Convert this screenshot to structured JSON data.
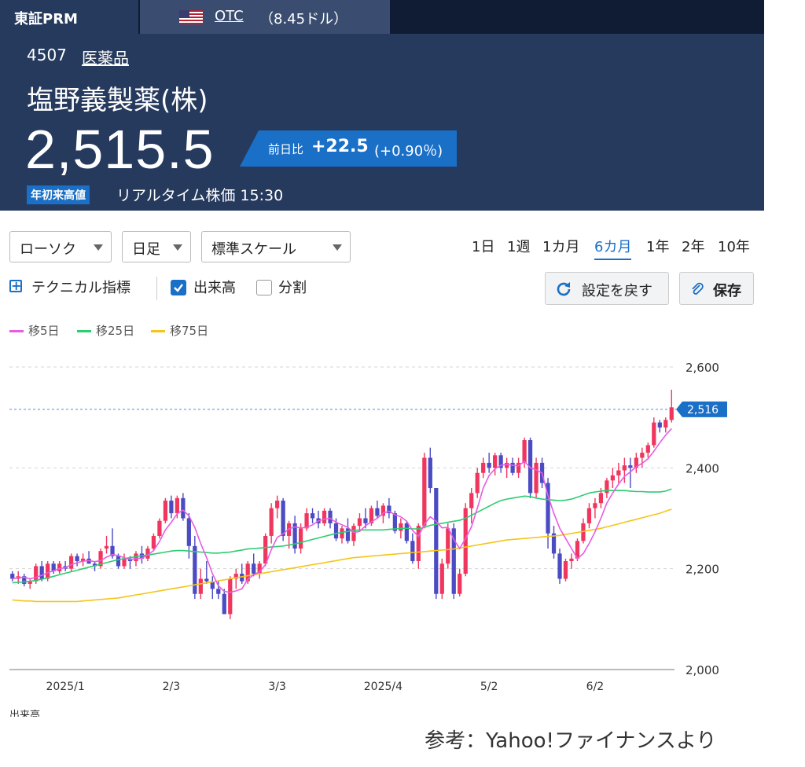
{
  "header": {
    "market_tab": "東証PRM",
    "otc_symbol": "OTC",
    "otc_price": "（8.45ドル）",
    "code": "4507",
    "sector": "医薬品",
    "company": "塩野義製薬(株)",
    "price": "2,515.5",
    "change_label": "前日比",
    "change_value": "+22.5",
    "change_pct": "(+0.90％)",
    "badge": "年初来高値",
    "realtime": "リアルタイム株価  15:30",
    "flag_icon": "us-flag-icon"
  },
  "controls": {
    "chart_type": "ローソク",
    "interval": "日足",
    "scale": "標準スケール",
    "periods": [
      {
        "label": "1日"
      },
      {
        "label": "1週"
      },
      {
        "label": "1カ月"
      },
      {
        "label": "6カ月",
        "active": true
      },
      {
        "label": "1年"
      },
      {
        "label": "2年"
      },
      {
        "label": "10年"
      }
    ],
    "technical": "テクニカル指標",
    "volume": "出来高",
    "volume_checked": true,
    "split": "分割",
    "split_checked": false,
    "reset": "設定を戻す",
    "save": "保存"
  },
  "legend": [
    {
      "label": "移5日",
      "color": "#e85ce0"
    },
    {
      "label": "移25日",
      "color": "#2ecc71"
    },
    {
      "label": "移75日",
      "color": "#f5c518"
    }
  ],
  "chart_data": {
    "type": "candlestick",
    "ylim": [
      2000,
      2600
    ],
    "yticks": [
      "2,600",
      "2,400",
      "2,200",
      "2,000"
    ],
    "current_label": "2,516",
    "current_value": 2516,
    "xticks": [
      {
        "label": "2025/1",
        "index": 9
      },
      {
        "label": "2/3",
        "index": 27
      },
      {
        "label": "3/3",
        "index": 45
      },
      {
        "label": "2025/4",
        "index": 63
      },
      {
        "label": "5/2",
        "index": 81
      },
      {
        "label": "6/2",
        "index": 99
      }
    ],
    "up_color": "#f0365e",
    "down_color": "#4b4bc4",
    "ohlc": [
      [
        2190,
        2195,
        2175,
        2180
      ],
      [
        2180,
        2195,
        2170,
        2185
      ],
      [
        2185,
        2190,
        2165,
        2170
      ],
      [
        2170,
        2180,
        2160,
        2175
      ],
      [
        2175,
        2210,
        2170,
        2205
      ],
      [
        2205,
        2215,
        2175,
        2180
      ],
      [
        2180,
        2215,
        2175,
        2210
      ],
      [
        2210,
        2215,
        2190,
        2195
      ],
      [
        2195,
        2215,
        2190,
        2210
      ],
      [
        2205,
        2215,
        2195,
        2200
      ],
      [
        2200,
        2230,
        2195,
        2225
      ],
      [
        2225,
        2230,
        2205,
        2215
      ],
      [
        2215,
        2230,
        2205,
        2220
      ],
      [
        2220,
        2235,
        2210,
        2210
      ],
      [
        2210,
        2215,
        2195,
        2205
      ],
      [
        2205,
        2240,
        2200,
        2235
      ],
      [
        2240,
        2265,
        2230,
        2245
      ],
      [
        2245,
        2280,
        2220,
        2225
      ],
      [
        2225,
        2230,
        2200,
        2205
      ],
      [
        2205,
        2230,
        2200,
        2220
      ],
      [
        2220,
        2225,
        2200,
        2215
      ],
      [
        2215,
        2235,
        2205,
        2230
      ],
      [
        2230,
        2245,
        2210,
        2220
      ],
      [
        2220,
        2245,
        2215,
        2240
      ],
      [
        2240,
        2270,
        2235,
        2265
      ],
      [
        2265,
        2300,
        2260,
        2295
      ],
      [
        2295,
        2340,
        2290,
        2335
      ],
      [
        2335,
        2345,
        2300,
        2310
      ],
      [
        2310,
        2345,
        2300,
        2340
      ],
      [
        2340,
        2350,
        2295,
        2300
      ],
      [
        2300,
        2310,
        2220,
        2245
      ],
      [
        2245,
        2265,
        2140,
        2150
      ],
      [
        2150,
        2200,
        2140,
        2180
      ],
      [
        2180,
        2215,
        2170,
        2175
      ],
      [
        2175,
        2185,
        2140,
        2160
      ],
      [
        2160,
        2175,
        2140,
        2150
      ],
      [
        2150,
        2160,
        2110,
        2110
      ],
      [
        2110,
        2185,
        2100,
        2180
      ],
      [
        2180,
        2200,
        2160,
        2190
      ],
      [
        2190,
        2210,
        2170,
        2175
      ],
      [
        2175,
        2215,
        2170,
        2210
      ],
      [
        2210,
        2230,
        2185,
        2190
      ],
      [
        2190,
        2215,
        2180,
        2210
      ],
      [
        2210,
        2270,
        2205,
        2265
      ],
      [
        2265,
        2330,
        2250,
        2320
      ],
      [
        2320,
        2345,
        2300,
        2335
      ],
      [
        2335,
        2340,
        2255,
        2265
      ],
      [
        2265,
        2295,
        2240,
        2290
      ],
      [
        2290,
        2305,
        2230,
        2240
      ],
      [
        2240,
        2290,
        2230,
        2280
      ],
      [
        2280,
        2320,
        2275,
        2310
      ],
      [
        2310,
        2320,
        2290,
        2300
      ],
      [
        2300,
        2315,
        2280,
        2290
      ],
      [
        2290,
        2320,
        2285,
        2315
      ],
      [
        2315,
        2320,
        2280,
        2290
      ],
      [
        2290,
        2300,
        2255,
        2260
      ],
      [
        2260,
        2285,
        2250,
        2280
      ],
      [
        2280,
        2300,
        2250,
        2255
      ],
      [
        2255,
        2290,
        2245,
        2285
      ],
      [
        2285,
        2310,
        2275,
        2300
      ],
      [
        2300,
        2320,
        2280,
        2290
      ],
      [
        2290,
        2325,
        2285,
        2320
      ],
      [
        2320,
        2335,
        2300,
        2305
      ],
      [
        2305,
        2330,
        2290,
        2325
      ],
      [
        2325,
        2340,
        2300,
        2310
      ],
      [
        2310,
        2315,
        2270,
        2275
      ],
      [
        2275,
        2300,
        2260,
        2290
      ],
      [
        2290,
        2295,
        2250,
        2255
      ],
      [
        2255,
        2270,
        2210,
        2215
      ],
      [
        2215,
        2290,
        2200,
        2285
      ],
      [
        2285,
        2430,
        2280,
        2420
      ],
      [
        2420,
        2440,
        2350,
        2360
      ],
      [
        2360,
        2290,
        2140,
        2150
      ],
      [
        2150,
        2220,
        2140,
        2210
      ],
      [
        2210,
        2290,
        2200,
        2280
      ],
      [
        2280,
        2290,
        2140,
        2150
      ],
      [
        2150,
        2200,
        2145,
        2190
      ],
      [
        2190,
        2330,
        2185,
        2320
      ],
      [
        2320,
        2360,
        2290,
        2350
      ],
      [
        2350,
        2400,
        2340,
        2390
      ],
      [
        2390,
        2420,
        2380,
        2410
      ],
      [
        2410,
        2430,
        2390,
        2400
      ],
      [
        2400,
        2430,
        2385,
        2425
      ],
      [
        2425,
        2430,
        2390,
        2400
      ],
      [
        2400,
        2420,
        2380,
        2410
      ],
      [
        2410,
        2420,
        2385,
        2390
      ],
      [
        2390,
        2420,
        2380,
        2410
      ],
      [
        2410,
        2460,
        2400,
        2455
      ],
      [
        2455,
        2460,
        2340,
        2350
      ],
      [
        2350,
        2420,
        2340,
        2410
      ],
      [
        2410,
        2420,
        2360,
        2370
      ],
      [
        2370,
        2380,
        2240,
        2270
      ],
      [
        2270,
        2285,
        2220,
        2230
      ],
      [
        2230,
        2240,
        2170,
        2180
      ],
      [
        2180,
        2220,
        2175,
        2215
      ],
      [
        2215,
        2230,
        2200,
        2220
      ],
      [
        2220,
        2260,
        2215,
        2255
      ],
      [
        2255,
        2300,
        2250,
        2290
      ],
      [
        2290,
        2330,
        2280,
        2320
      ],
      [
        2320,
        2340,
        2300,
        2330
      ],
      [
        2330,
        2360,
        2320,
        2350
      ],
      [
        2350,
        2380,
        2340,
        2375
      ],
      [
        2375,
        2400,
        2360,
        2385
      ],
      [
        2385,
        2410,
        2370,
        2395
      ],
      [
        2395,
        2420,
        2370,
        2405
      ],
      [
        2405,
        2420,
        2360,
        2400
      ],
      [
        2400,
        2430,
        2390,
        2420
      ],
      [
        2420,
        2440,
        2400,
        2430
      ],
      [
        2430,
        2450,
        2420,
        2445
      ],
      [
        2445,
        2500,
        2440,
        2490
      ],
      [
        2490,
        2495,
        2470,
        2480
      ],
      [
        2480,
        2500,
        2470,
        2495
      ],
      [
        2495,
        2555,
        2490,
        2520
      ]
    ],
    "ma5": [
      2180,
      2182,
      2183,
      2180,
      2183,
      2187,
      2192,
      2196,
      2200,
      2202,
      2208,
      2212,
      2215,
      2216,
      2214,
      2216,
      2223,
      2228,
      2226,
      2222,
      2218,
      2220,
      2221,
      2227,
      2236,
      2254,
      2277,
      2292,
      2309,
      2316,
      2305,
      2282,
      2250,
      2222,
      2190,
      2166,
      2155,
      2153,
      2156,
      2160,
      2179,
      2188,
      2194,
      2208,
      2238,
      2262,
      2269,
      2279,
      2283,
      2281,
      2282,
      2287,
      2295,
      2298,
      2300,
      2292,
      2287,
      2282,
      2272,
      2274,
      2285,
      2293,
      2300,
      2310,
      2314,
      2307,
      2303,
      2294,
      2276,
      2264,
      2288,
      2303,
      2294,
      2281,
      2282,
      2258,
      2240,
      2260,
      2283,
      2320,
      2360,
      2385,
      2398,
      2405,
      2407,
      2405,
      2404,
      2413,
      2400,
      2396,
      2390,
      2345,
      2310,
      2280,
      2260,
      2240,
      2220,
      2230,
      2250,
      2273,
      2300,
      2330,
      2350,
      2368,
      2383,
      2392,
      2402,
      2409,
      2418,
      2433,
      2450,
      2465,
      2478
    ],
    "ma25": [
      2172,
      2173,
      2174,
      2175,
      2177,
      2179,
      2182,
      2185,
      2188,
      2191,
      2194,
      2197,
      2200,
      2203,
      2206,
      2209,
      2212,
      2215,
      2218,
      2220,
      2222,
      2224,
      2226,
      2227,
      2229,
      2231,
      2233,
      2235,
      2236,
      2236,
      2235,
      2234,
      2233,
      2232,
      2231,
      2231,
      2232,
      2233,
      2235,
      2237,
      2239,
      2240,
      2241,
      2242,
      2243,
      2244,
      2245,
      2247,
      2249,
      2252,
      2255,
      2258,
      2261,
      2264,
      2267,
      2270,
      2272,
      2274,
      2276,
      2277,
      2277,
      2277,
      2277,
      2277,
      2278,
      2279,
      2280,
      2280,
      2279,
      2279,
      2282,
      2286,
      2288,
      2290,
      2292,
      2294,
      2296,
      2300,
      2306,
      2312,
      2318,
      2324,
      2330,
      2335,
      2338,
      2340,
      2342,
      2344,
      2343,
      2340,
      2338,
      2337,
      2336,
      2335,
      2336,
      2338,
      2342,
      2346,
      2350,
      2352,
      2354,
      2355,
      2355,
      2355,
      2355,
      2354,
      2353,
      2353,
      2352,
      2352,
      2352,
      2354,
      2358
    ],
    "ma75": [
      2138,
      2137,
      2136,
      2136,
      2135,
      2135,
      2135,
      2135,
      2135,
      2135,
      2135,
      2135,
      2136,
      2137,
      2138,
      2139,
      2140,
      2141,
      2142,
      2144,
      2146,
      2148,
      2150,
      2152,
      2154,
      2156,
      2158,
      2160,
      2162,
      2164,
      2166,
      2168,
      2170,
      2172,
      2174,
      2176,
      2178,
      2180,
      2182,
      2184,
      2186,
      2188,
      2190,
      2192,
      2194,
      2196,
      2198,
      2200,
      2202,
      2204,
      2206,
      2208,
      2210,
      2212,
      2214,
      2216,
      2218,
      2220,
      2222,
      2223,
      2224,
      2225,
      2226,
      2227,
      2228,
      2229,
      2230,
      2231,
      2232,
      2233,
      2234,
      2235,
      2236,
      2237,
      2238,
      2239,
      2241,
      2243,
      2245,
      2247,
      2249,
      2251,
      2253,
      2255,
      2257,
      2258,
      2259,
      2260,
      2261,
      2262,
      2263,
      2264,
      2265,
      2266,
      2268,
      2270,
      2272,
      2274,
      2276,
      2278,
      2280,
      2283,
      2286,
      2289,
      2292,
      2295,
      2298,
      2301,
      2304,
      2307,
      2310,
      2314,
      2318
    ]
  },
  "volume_label": "出来高",
  "footer": "参考：Yahoo!ファイナンスより"
}
